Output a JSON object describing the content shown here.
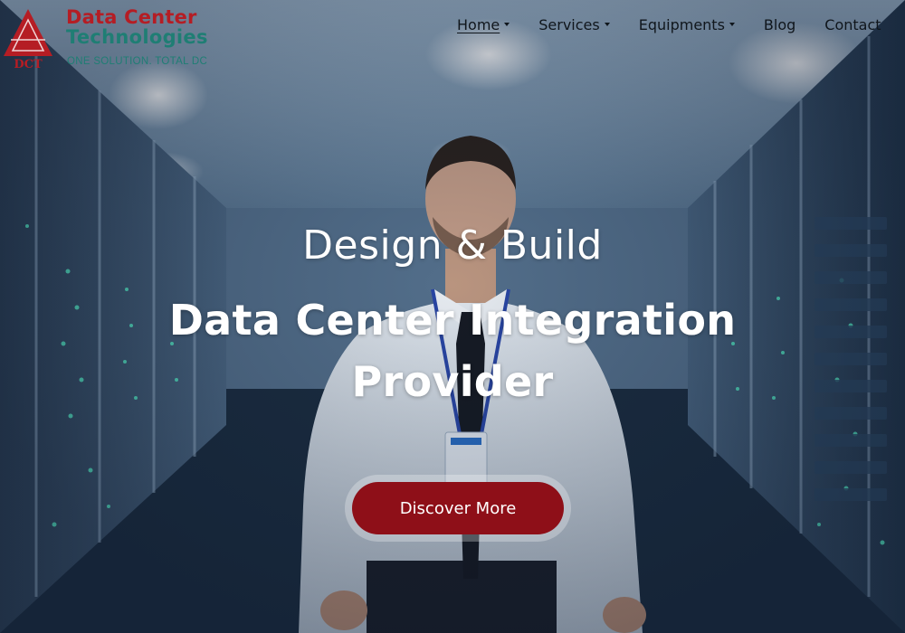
{
  "brand": {
    "title": "Data Center",
    "subtitle": "Technologies",
    "tagline": "ONE SOLUTION. TOTAL DC",
    "mark_text": "DCT",
    "colors": {
      "red": "#b51d24",
      "teal": "#1f7e74"
    }
  },
  "nav": {
    "items": [
      {
        "label": "Home",
        "has_dropdown": true,
        "active": true
      },
      {
        "label": "Services",
        "has_dropdown": true,
        "active": false
      },
      {
        "label": "Equipments",
        "has_dropdown": true,
        "active": false
      },
      {
        "label": "Blog",
        "has_dropdown": false,
        "active": false
      },
      {
        "label": "Contact",
        "has_dropdown": false,
        "active": false
      }
    ]
  },
  "hero": {
    "pre_title": "Design & Build",
    "title": "Data Center Integration Provider",
    "cta_label": "Discover More",
    "cta_color": "#8e0f18"
  }
}
